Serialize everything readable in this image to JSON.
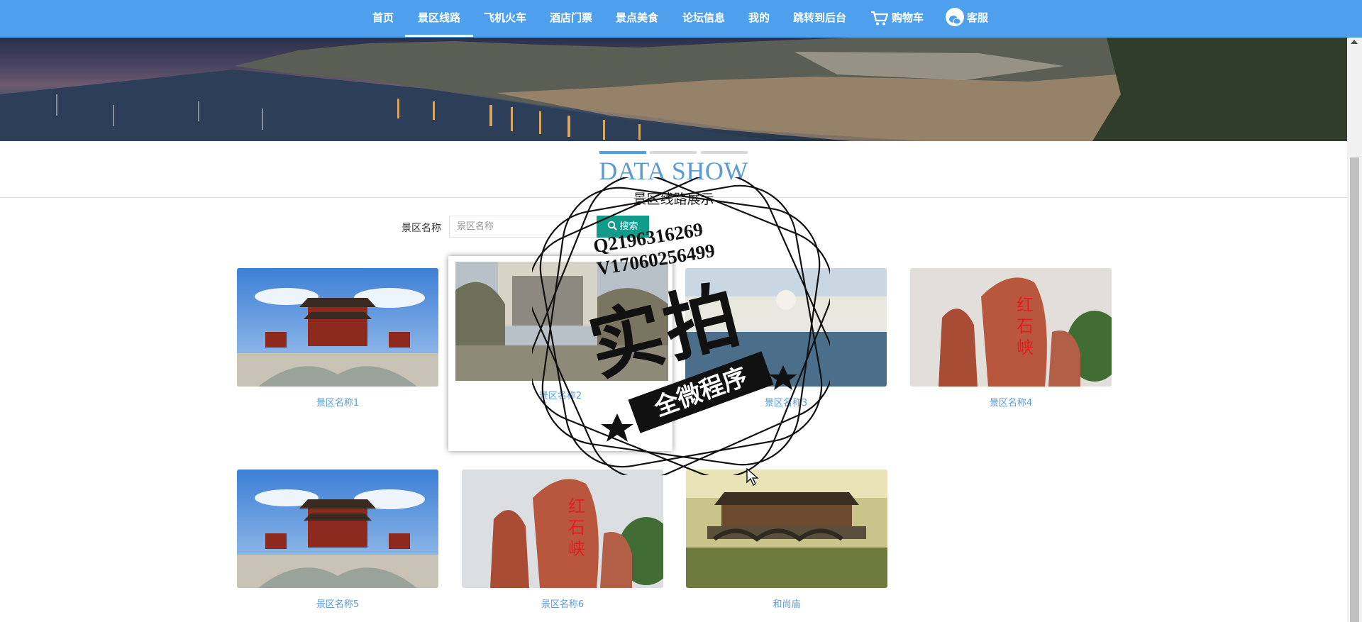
{
  "nav": {
    "items": [
      {
        "label": "首页",
        "active": false
      },
      {
        "label": "景区线路",
        "active": true
      },
      {
        "label": "飞机火车",
        "active": false
      },
      {
        "label": "酒店门票",
        "active": false
      },
      {
        "label": "景点美食",
        "active": false
      },
      {
        "label": "论坛信息",
        "active": false
      },
      {
        "label": "我的",
        "active": false
      },
      {
        "label": "跳转到后台",
        "active": false
      }
    ],
    "cart": {
      "label": "购物车",
      "icon": "cart-icon"
    },
    "service": {
      "label": "客服",
      "icon": "chat-icon"
    }
  },
  "section": {
    "title": "DATA SHOW",
    "subtitle": "景区线路展示"
  },
  "search": {
    "label": "景区名称",
    "placeholder": "景区名称",
    "button_label": "搜索",
    "button_icon": "search-icon"
  },
  "cards": [
    {
      "name": "景区名称1"
    },
    {
      "name": "景区名称2"
    },
    {
      "name": "景区名称3"
    },
    {
      "name": "景区名称4"
    },
    {
      "name": "景区名称5"
    },
    {
      "name": "景区名称6"
    },
    {
      "name": "和尚庙"
    }
  ],
  "watermark": {
    "contact_1": "Q2196316269",
    "contact_2": "V17060256499",
    "main": "实拍",
    "ribbon": "全微程序"
  },
  "colors": {
    "nav_bg": "#4fa0ec",
    "accent": "#5b9bd5",
    "search_button": "#119b8a"
  }
}
